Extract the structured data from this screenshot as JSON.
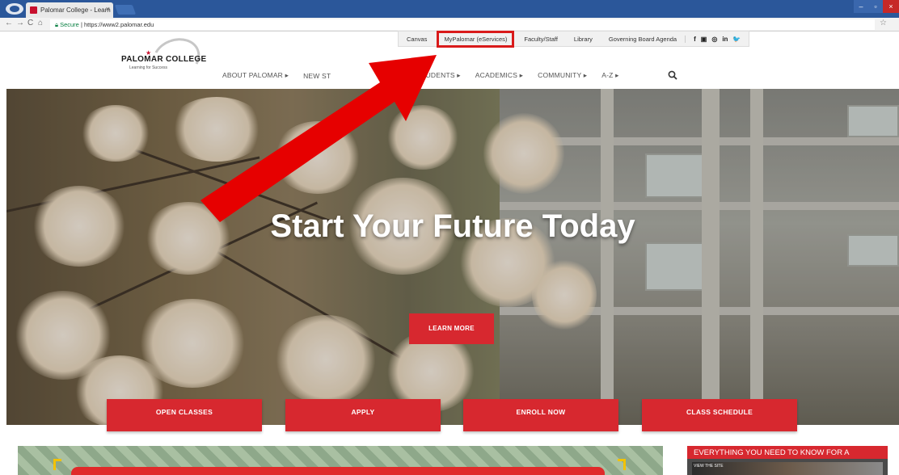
{
  "browser": {
    "tab_title": "Palomar College - Learn",
    "tab_close": "×",
    "back_glyph": "←",
    "forward_glyph": "→",
    "reload_glyph": "C",
    "home_glyph": "⌂",
    "secure_label": "Secure",
    "url": "https://www2.palomar.edu",
    "star_glyph": "☆",
    "minimize": "–",
    "maximize": "▫",
    "close": "×"
  },
  "utility_nav": {
    "items": [
      "Canvas",
      "MyPalomar (eServices)",
      "Faculty/Staff",
      "Library",
      "Governing Board Agenda"
    ],
    "highlighted_index": 1,
    "highlight_color": "#d91a1a",
    "social": [
      "f",
      "▣",
      "◎",
      "in",
      "🐦"
    ]
  },
  "logo": {
    "name": "PALOMAR COLLEGE",
    "tagline": "Learning for Success",
    "star": "★"
  },
  "main_nav": {
    "items": [
      "ABOUT PALOMAR ▸",
      "NEW ST",
      "ENT STUDENTS ▸",
      "ACADEMICS ▸",
      "COMMUNITY ▸",
      "A-Z ▸"
    ],
    "search_icon": "search-icon"
  },
  "hero": {
    "title": "Start Your Future Today",
    "learn_more": "LEARN MORE"
  },
  "cta_buttons": [
    "OPEN CLASSES",
    "APPLY",
    "ENROLL NOW",
    "CLASS SCHEDULE"
  ],
  "news": {
    "title": "EVERYTHING YOU NEED TO KNOW FOR A",
    "tag": "VIEW THE SITE"
  },
  "colors": {
    "brand_red": "#d7282f",
    "annotation_red": "#e60000"
  }
}
